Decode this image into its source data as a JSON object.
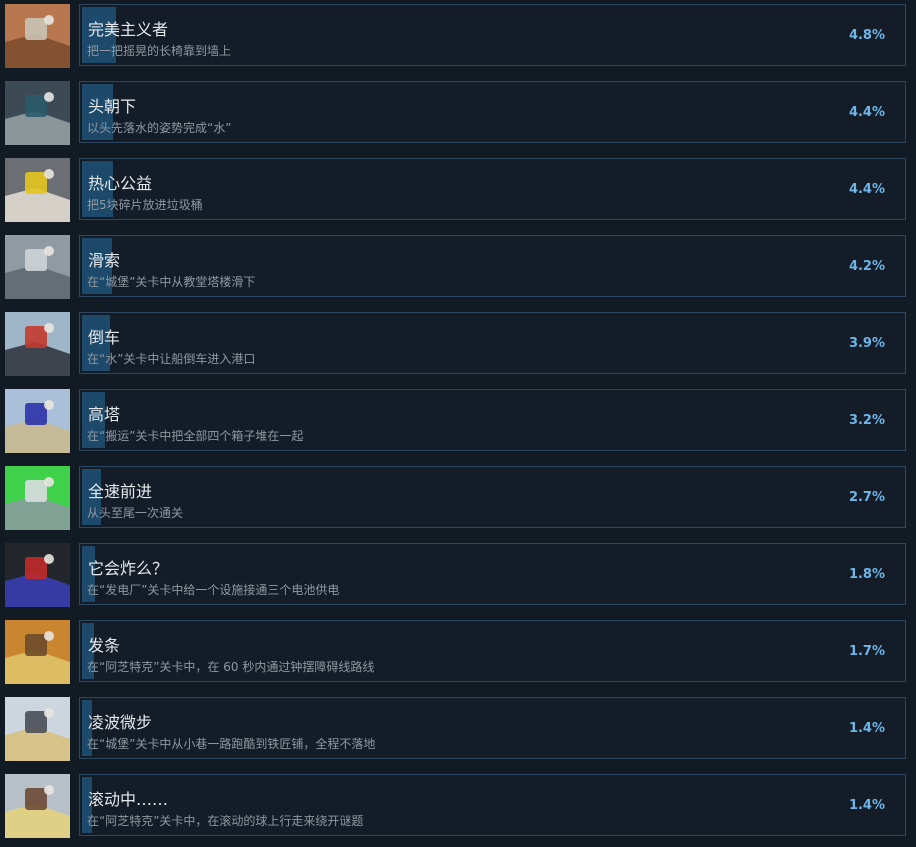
{
  "achievements": [
    {
      "title": "完美主义者",
      "description": "把一把摇晃的长椅靠到墙上",
      "percent_label": "4.8%",
      "percent": 4.8,
      "icon": "bench-scene-thumbnail",
      "colors": [
        "#b8774f",
        "#c9c2b4",
        "#7a4a2b"
      ]
    },
    {
      "title": "头朝下",
      "description": "以头先落水的姿势完成“水”",
      "percent_label": "4.4%",
      "percent": 4.4,
      "icon": "water-dive-thumbnail",
      "colors": [
        "#3b4a55",
        "#2a5b6a",
        "#9aa3a8"
      ]
    },
    {
      "title": "热心公益",
      "description": "把5块碎片放进垃圾桶",
      "percent_label": "4.4%",
      "percent": 4.4,
      "icon": "trash-bin-thumbnail",
      "colors": [
        "#6b6e73",
        "#e6c51f",
        "#e8e2d6"
      ]
    },
    {
      "title": "滑索",
      "description": "在“城堡”关卡中从教堂塔楼滑下",
      "percent_label": "4.2%",
      "percent": 4.2,
      "icon": "zipline-thumbnail",
      "colors": [
        "#8f9aa3",
        "#cfd4d8",
        "#5d6670"
      ]
    },
    {
      "title": "倒车",
      "description": "在“水”关卡中让船倒车进入港口",
      "percent_label": "3.9%",
      "percent": 3.9,
      "icon": "boat-harbor-thumbnail",
      "colors": [
        "#9fb6c8",
        "#c23b2e",
        "#2d3038"
      ]
    },
    {
      "title": "高塔",
      "description": "在“搬运”关卡中把全部四个箱子堆在一起",
      "percent_label": "3.2%",
      "percent": 3.2,
      "icon": "tower-crates-thumbnail",
      "colors": [
        "#aac0d8",
        "#2b33a8",
        "#c9b98d"
      ]
    },
    {
      "title": "全速前进",
      "description": "从头至尾一次通关",
      "percent_label": "2.7%",
      "percent": 2.7,
      "icon": "speedrun-thumbnail",
      "colors": [
        "#3fd14a",
        "#d9dde0",
        "#8f9aa3"
      ]
    },
    {
      "title": "它会炸么？",
      "description": "在“发电厂”关卡中给一个设施接通三个电池供电",
      "percent_label": "1.8%",
      "percent": 1.8,
      "icon": "battery-wires-thumbnail",
      "colors": [
        "#23262b",
        "#c22a2a",
        "#3a3fb8"
      ]
    },
    {
      "title": "发条",
      "description": "在“阿芝特克”关卡中，在 60 秒内通过钟摆障碍线路线",
      "percent_label": "1.7%",
      "percent": 1.7,
      "icon": "clockwork-thumbnail",
      "colors": [
        "#c9862f",
        "#6b4a2a",
        "#e2c56c"
      ]
    },
    {
      "title": "凌波微步",
      "description": "在“城堡”关卡中从小巷一路跑酷到铁匠铺，全程不落地",
      "percent_label": "1.4%",
      "percent": 1.4,
      "icon": "parkour-thumbnail",
      "colors": [
        "#cdd6de",
        "#4a4f56",
        "#d8c07a"
      ]
    },
    {
      "title": "滚动中……",
      "description": "在“阿芝特克”关卡中，在滚动的球上行走来绕开谜题",
      "percent_label": "1.4%",
      "percent": 1.4,
      "icon": "rolling-ball-thumbnail",
      "colors": [
        "#b9c1c8",
        "#6d4a36",
        "#e6d27a"
      ]
    }
  ]
}
